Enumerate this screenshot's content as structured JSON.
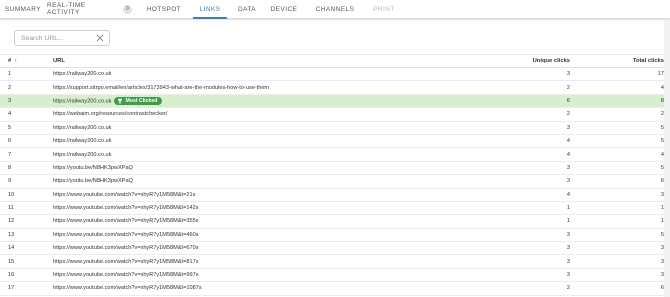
{
  "tabs": [
    {
      "label": "SUMMARY"
    },
    {
      "label": "REAL-TIME ACTIVITY",
      "badge": "0"
    },
    {
      "label": "HOTSPOT"
    },
    {
      "label": "LINKS"
    },
    {
      "label": "DATA"
    },
    {
      "label": "DEVICE"
    },
    {
      "label": "CHANNELS"
    },
    {
      "label": "PRINT"
    }
  ],
  "search": {
    "placeholder": "Search URL..."
  },
  "table": {
    "headers": {
      "num": "#",
      "url": "URL",
      "unique": "Unique clicks",
      "total": "Total clicks"
    },
    "sort_indicator": "↑",
    "most_clicked_label": "Most Clicked",
    "rows": [
      {
        "num": "1",
        "url": "https://railway200.co.uk",
        "unique": "3",
        "total": "17"
      },
      {
        "num": "2",
        "url": "https://support.sitrpo.email/en/articles/3173943-what-are-the-modules-how-to-use-them",
        "unique": "2",
        "total": "4"
      },
      {
        "num": "3",
        "url": "https://railway200.co.uk",
        "unique": "6",
        "total": "8",
        "most_clicked": true
      },
      {
        "num": "4",
        "url": "https://webaim.org/resources/contrastchecker/",
        "unique": "2",
        "total": "2"
      },
      {
        "num": "5",
        "url": "https://railway200.co.uk",
        "unique": "3",
        "total": "5"
      },
      {
        "num": "6",
        "url": "https://railway200.co.uk",
        "unique": "4",
        "total": "5"
      },
      {
        "num": "7",
        "url": "https://railway200.co.uk",
        "unique": "4",
        "total": "4"
      },
      {
        "num": "8",
        "url": "https://youtu.be/N8HK3pwXPaQ",
        "unique": "3",
        "total": "5"
      },
      {
        "num": "9",
        "url": "https://youtu.be/N8HK3pwXPaQ",
        "unique": "3",
        "total": "6"
      },
      {
        "num": "10",
        "url": "https://www.youtube.com/watch?v=xhyR7y1M58M&t=21s",
        "unique": "4",
        "total": "3"
      },
      {
        "num": "11",
        "url": "https://www.youtube.com/watch?v=xhyR7y1M58M&t=142s",
        "unique": "1",
        "total": "1"
      },
      {
        "num": "12",
        "url": "https://www.youtube.com/watch?v=xhyR7y1M58M&t=355s",
        "unique": "1",
        "total": "1"
      },
      {
        "num": "13",
        "url": "https://www.youtube.com/watch?v=xhyR7y1M58M&t=460s",
        "unique": "3",
        "total": "5"
      },
      {
        "num": "14",
        "url": "https://www.youtube.com/watch?v=xhyR7y1M58M&t=670s",
        "unique": "3",
        "total": "3"
      },
      {
        "num": "15",
        "url": "https://www.youtube.com/watch?v=xhyR7y1M58M&t=817s",
        "unique": "3",
        "total": "3"
      },
      {
        "num": "16",
        "url": "https://www.youtube.com/watch?v=xhyR7y1M58M&t=997s",
        "unique": "3",
        "total": "3"
      },
      {
        "num": "17",
        "url": "https://www.youtube.com/watch?v=xhyR7y1M58M&t=1087s",
        "unique": "2",
        "total": "6"
      }
    ]
  },
  "colors": {
    "accent": "#3d7fb8",
    "highlight_row": "#d6efcd",
    "most_clicked_pill": "#3f9c48"
  },
  "icons": {
    "clear": "close-icon",
    "trophy": "trophy-icon",
    "sort": "arrow-up-icon"
  }
}
